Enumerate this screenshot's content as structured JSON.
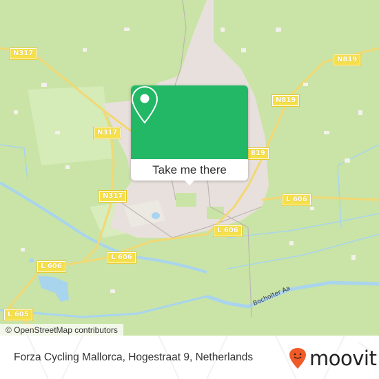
{
  "map": {
    "road_labels": [
      {
        "id": "n317-a",
        "text": "N317"
      },
      {
        "id": "n317-b",
        "text": "N317"
      },
      {
        "id": "n317-c",
        "text": "N317"
      },
      {
        "id": "n819-a",
        "text": "N819"
      },
      {
        "id": "n819-b",
        "text": "N819"
      },
      {
        "id": "n819-c",
        "text": "819"
      },
      {
        "id": "l606-a",
        "text": "L 606"
      },
      {
        "id": "l606-b",
        "text": "L 606"
      },
      {
        "id": "l606-c",
        "text": "L 606"
      },
      {
        "id": "l606-d",
        "text": "L 606"
      },
      {
        "id": "l605",
        "text": "L 605"
      }
    ],
    "river_label": "Bocholter Aa",
    "attribution": "© OpenStreetMap contributors",
    "colors": {
      "land": "#c9e4a6",
      "urban": "#e8e0dc",
      "water": "#a9d4ee",
      "road": "#f7d774",
      "popup_green": "#22b866"
    }
  },
  "popup": {
    "icon": "map-pin-icon",
    "button_label": "Take me there"
  },
  "footer": {
    "address": "Forza Cycling Mallorca, Hogestraat 9, Netherlands",
    "logo_text": "moovit",
    "logo_color": "#f05a28"
  }
}
